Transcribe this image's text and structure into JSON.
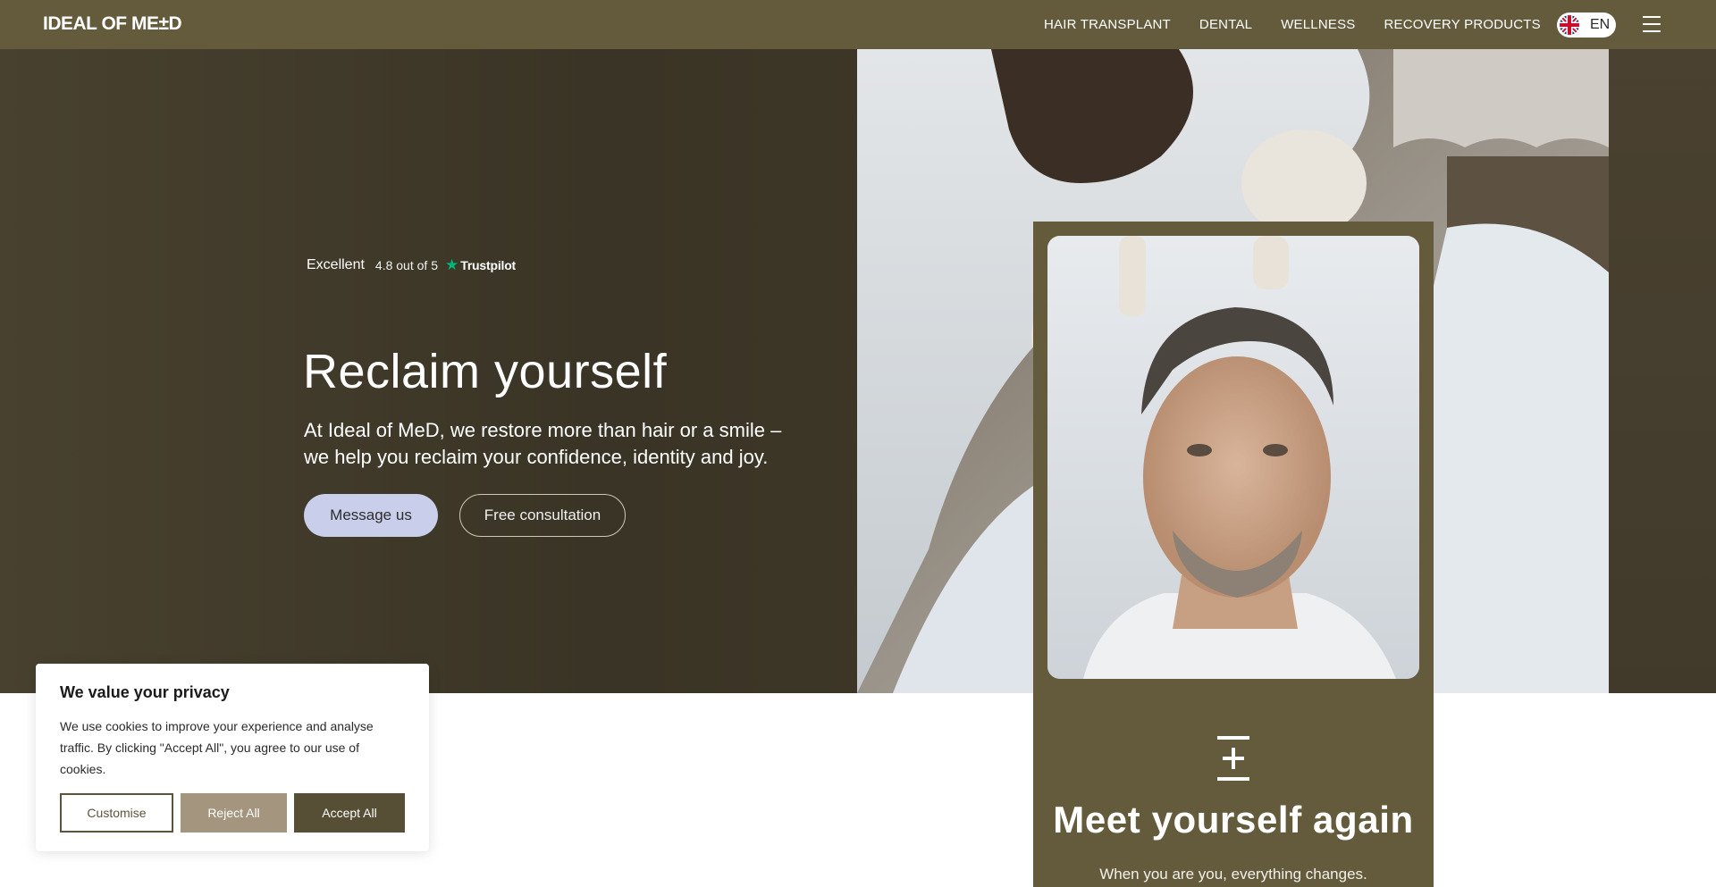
{
  "header": {
    "logo_text": "IDEAL OF ME±D",
    "nav": [
      "HAIR TRANSPLANT",
      "DENTAL",
      "WELLNESS",
      "RECOVERY PRODUCTS"
    ],
    "language": "EN",
    "icons": {
      "flag": "uk-flag-icon",
      "menu": "hamburger-menu-icon"
    }
  },
  "hero": {
    "rating_label": "Excellent",
    "rating_score": "4.8 out of 5",
    "rating_brand": "Trustpilot",
    "title": "Reclaim yourself",
    "subtitle": "At Ideal of MeD, we restore more than hair or a smile – we help you reclaim your confidence, identity and joy.",
    "primary_button": "Message us",
    "secondary_button": "Free consultation"
  },
  "feature_card": {
    "title": "Meet yourself again",
    "text": "When you are you, everything changes."
  },
  "cookie_banner": {
    "title": "We value your privacy",
    "text": "We use cookies to improve your experience and analyse traffic. By clicking \"Accept All\", you agree to our use of cookies.",
    "customise": "Customise",
    "reject": "Reject All",
    "accept": "Accept All"
  },
  "colors": {
    "brand_olive": "#645b3c",
    "primary_button": "#c9cfea",
    "trustpilot_green": "#00b67a",
    "reject_button": "#a4957e",
    "accept_button": "#564f36"
  }
}
